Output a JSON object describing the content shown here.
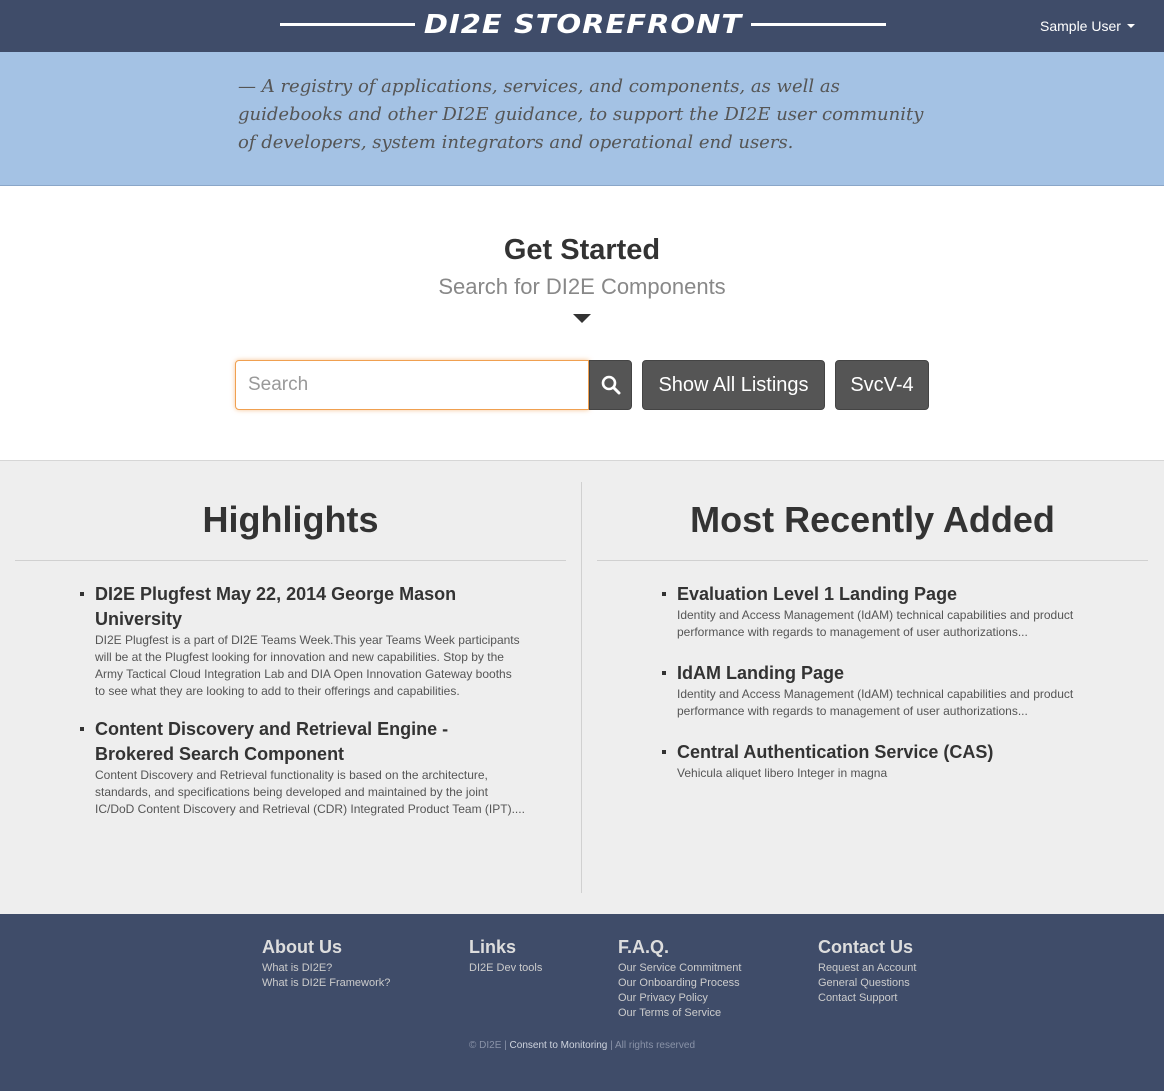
{
  "header": {
    "brand": "DI2E STOREFRONT",
    "user_label": "Sample User"
  },
  "tagline": "— A registry of applications, services, and components, as well as guidebooks and other DI2E guidance, to support the DI2E user community of developers, system integrators and operational end users.",
  "get_started": {
    "title": "Get Started",
    "subtitle": "Search for DI2E Components",
    "search_placeholder": "Search",
    "show_all_label": "Show All Listings",
    "svcv4_label": "SvcV-4"
  },
  "highlights": {
    "title": "Highlights",
    "items": [
      {
        "title": "DI2E Plugfest May 22, 2014 George Mason University",
        "desc": "DI2E Plugfest is a part of DI2E Teams Week.This year Teams Week participants will be at the Plugfest looking for innovation and new capabilities. Stop by the Army Tactical Cloud Integration Lab and DIA Open Innovation Gateway booths to see what they are looking to add to their offerings and capabilities."
      },
      {
        "title": "Content Discovery and Retrieval Engine - Brokered Search Component",
        "desc": "Content Discovery and Retrieval functionality is based on the architecture, standards, and specifications being developed and maintained by the joint IC/DoD Content Discovery and Retrieval (CDR) Integrated Product Team (IPT)...."
      }
    ]
  },
  "recent": {
    "title": "Most Recently Added",
    "items": [
      {
        "title": "Evaluation Level 1 Landing Page",
        "desc": "Identity and Access Management (IdAM) technical capabilities and product performance with regards to management of user authorizations..."
      },
      {
        "title": "IdAM Landing Page",
        "desc": "Identity and Access Management (IdAM) technical capabilities and product performance with regards to management of user authorizations..."
      },
      {
        "title": "Central Authentication Service (CAS)",
        "desc": "Vehicula aliquet libero Integer in magna"
      }
    ]
  },
  "footer": {
    "about": {
      "title": "About Us",
      "links": [
        "What is DI2E?",
        "What is DI2E Framework?"
      ]
    },
    "links": {
      "title": "Links",
      "links": [
        "DI2E Dev tools"
      ]
    },
    "faq": {
      "title": "F.A.Q.",
      "links": [
        "Our Service Commitment",
        "Our Onboarding Process",
        "Our Privacy Policy",
        "Our Terms of Service"
      ]
    },
    "contact": {
      "title": "Contact Us",
      "links": [
        "Request an Account",
        "General Questions",
        "Contact Support"
      ]
    },
    "copyright_prefix": "© DI2E |",
    "consent": "Consent to Monitoring",
    "copyright_suffix": "| All rights reserved"
  },
  "colors": {
    "navbar": "#3f4c69",
    "tagband": "#a4c2e4",
    "content_bg": "#eeeeee",
    "button_dark": "#555555",
    "search_focus": "#f0a050"
  },
  "icons": {
    "search_button": "search-icon",
    "user_menu": "caret-down-icon",
    "get_started": "triangle-down-icon"
  }
}
